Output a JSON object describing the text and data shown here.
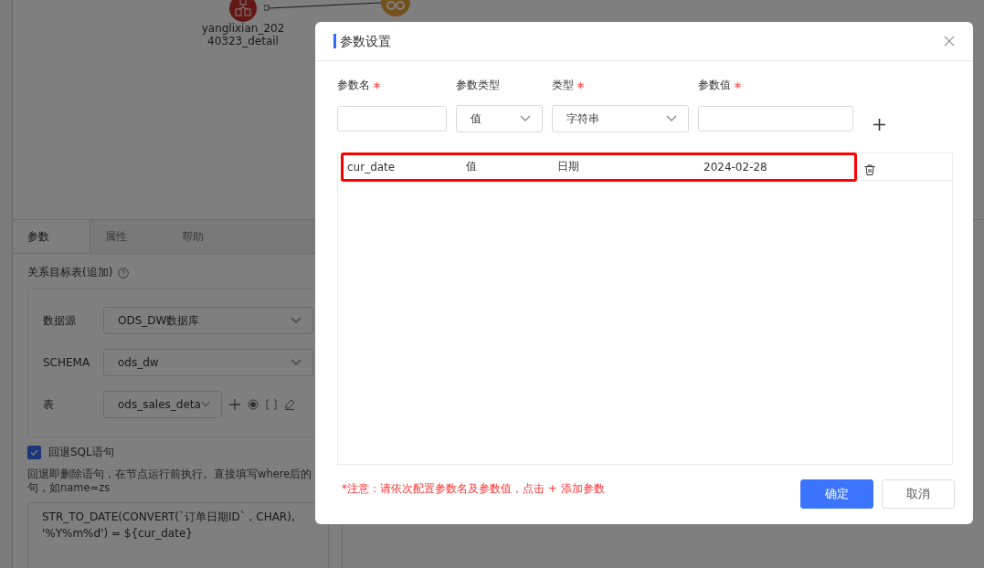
{
  "canvas": {
    "nodes": [
      {
        "label": "yanglixian_20240323_detail"
      }
    ]
  },
  "side_panel": {
    "tabs": [
      {
        "label": "参数",
        "selected": true
      },
      {
        "label": "属性",
        "selected": false
      },
      {
        "label": "帮助",
        "selected": false
      }
    ],
    "section_title": "关系目标表(追加)",
    "fields": [
      {
        "label": "数据源",
        "value": "ODS_DW数据库"
      },
      {
        "label": "SCHEMA",
        "value": "ods_dw"
      },
      {
        "label": "表",
        "value": "ods_sales_deta"
      }
    ],
    "rollback": {
      "label": "回退SQL语句",
      "checked": true
    },
    "hint": [
      "回退即删除语句，在节点运行前执行。直接填写where后的",
      "句，如name=zs"
    ],
    "sql": "STR_TO_DATE(CONVERT(`订单日期ID` , CHAR),\n'%Y%m%d') = ${cur_date}"
  },
  "dialog": {
    "title": "参数设置",
    "columns": [
      {
        "label": "参数名",
        "required": true
      },
      {
        "label": "参数类型",
        "required": false
      },
      {
        "label": "类型",
        "required": true
      },
      {
        "label": "参数值",
        "required": true
      }
    ],
    "inputs": {
      "param_type": "值",
      "type": "字符串"
    },
    "rows": [
      {
        "name": "cur_date",
        "param_type": "值",
        "type": "日期",
        "value": "2024-02-28",
        "highlighted": true
      }
    ],
    "note": "*注意：请依次配置参数名及参数值，点击 + 添加参数",
    "buttons": [
      {
        "label": "确定",
        "primary": true
      },
      {
        "label": "取消",
        "primary": false
      }
    ]
  }
}
